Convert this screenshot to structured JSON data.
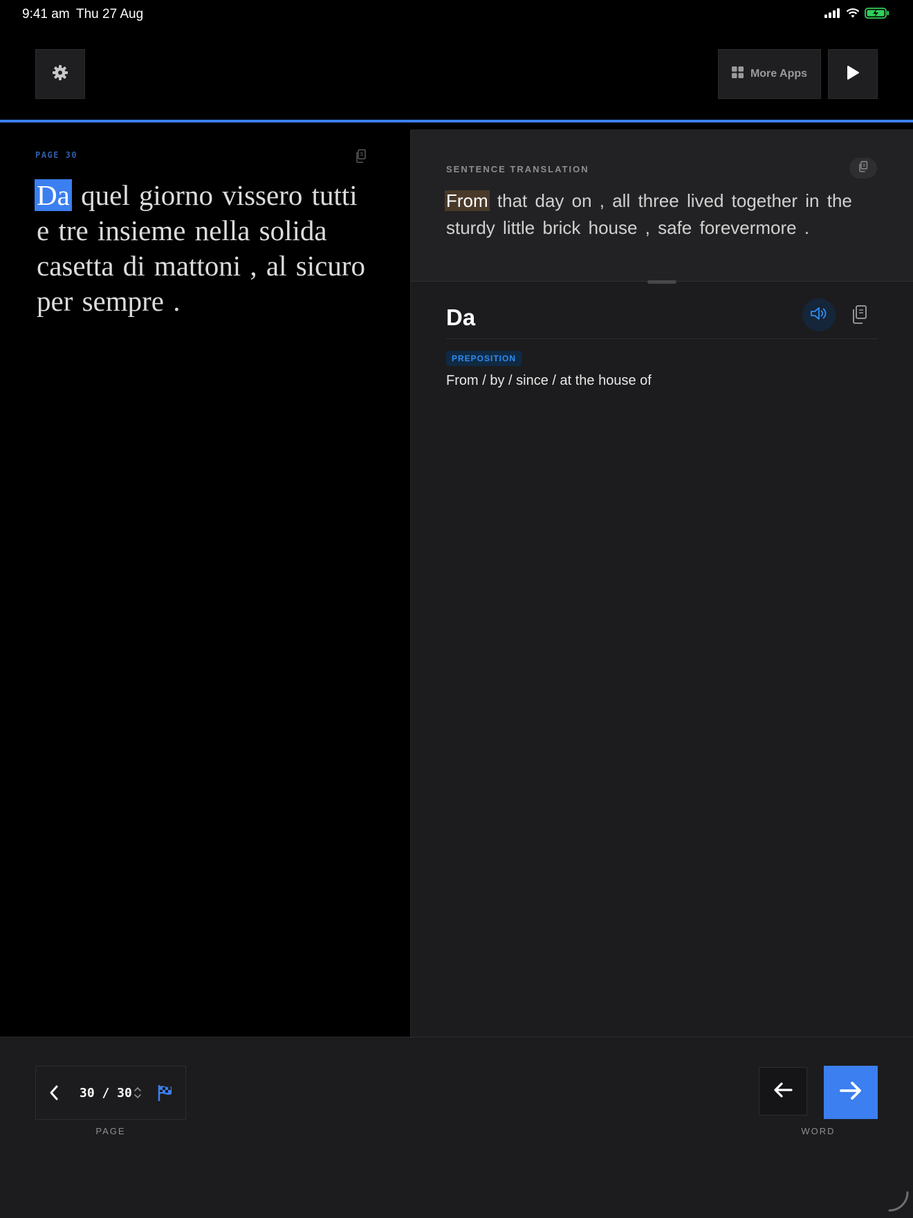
{
  "status_bar": {
    "time": "9:41 am",
    "date": "Thu 27 Aug",
    "icons": [
      "signal-icon",
      "wifi-icon",
      "battery-charging-icon"
    ],
    "battery_color": "#30d158"
  },
  "toolbar": {
    "settings_icon": "gear-icon",
    "more_apps_label": "More Apps",
    "more_apps_icon": "grid-icon",
    "play_icon": "play-icon"
  },
  "accent_color": "#3b7ff0",
  "reader": {
    "page_label": "PAGE 30",
    "highlighted_word": "Da",
    "text_rest": " quel giorno vissero tutti e tre insieme nella solida casetta di mattoni , al sicuro per sempre ."
  },
  "translation": {
    "label": "SENTENCE TRANSLATION",
    "highlighted_word": "From",
    "text_rest": " that day on , all three lived together in the sturdy little brick house , safe forevermore ."
  },
  "word_detail": {
    "word": "Da",
    "part_of_speech": "PREPOSITION",
    "meaning": "From / by / since / at the house of",
    "badge_color": "#2f8cf0"
  },
  "pager": {
    "current": "30",
    "total": "30",
    "display": "30 / 30",
    "caption": "PAGE"
  },
  "word_nav": {
    "caption": "WORD"
  }
}
